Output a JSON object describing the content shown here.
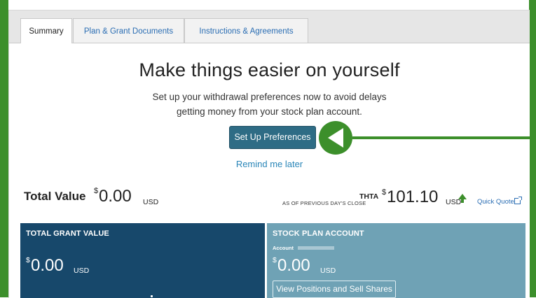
{
  "tabs": [
    {
      "label": "Summary"
    },
    {
      "label": "Plan & Grant Documents"
    },
    {
      "label": "Instructions & Agreements"
    }
  ],
  "promo": {
    "headline": "Make things easier on yourself",
    "line1": "Set up your withdrawal preferences now to avoid delays",
    "line2": "getting money from your stock plan account.",
    "cta_label": "Set Up Preferences",
    "remind_label": "Remind me later"
  },
  "total_value": {
    "label": "Total Value",
    "currency_symbol": "$",
    "amount": "0.00",
    "unit": "USD"
  },
  "quote": {
    "symbol": "THTA",
    "as_of": "AS OF PREVIOUS DAY'S CLOSE",
    "currency_symbol": "$",
    "price": "101.10",
    "unit": "USD",
    "quick_quote_label": "Quick Quote"
  },
  "grant_card": {
    "title": "TOTAL GRANT VALUE",
    "currency_symbol": "$",
    "amount": "0.00",
    "unit": "USD"
  },
  "stock_card": {
    "title": "STOCK PLAN ACCOUNT",
    "account_label": "Account",
    "currency_symbol": "$",
    "amount": "0.00",
    "unit": "USD",
    "button_label": "View Positions and Sell Shares"
  },
  "colors": {
    "highlight_green": "#3c8f2b",
    "grant_card": "#17486b",
    "stock_card": "#6fa2b5",
    "cta": "#2e6c85",
    "link": "#2a6db3"
  },
  "icons": {
    "quote_trend": "up-arrow-icon",
    "external_link": "external-link-icon",
    "pointer": "left-arrow-callout-icon"
  }
}
